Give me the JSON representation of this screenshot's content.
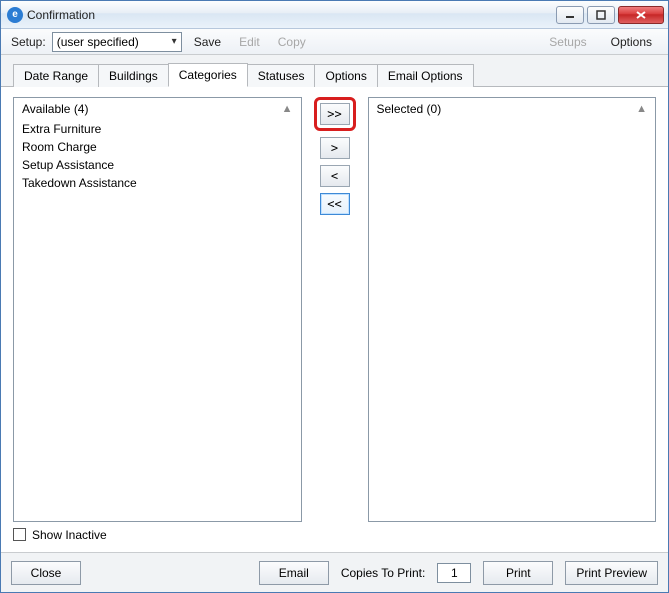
{
  "window": {
    "title": "Confirmation"
  },
  "toolbar": {
    "setup_label": "Setup:",
    "setup_value": "(user specified)",
    "save": "Save",
    "edit": "Edit",
    "copy": "Copy",
    "setups": "Setups",
    "options": "Options"
  },
  "tabs": {
    "date_range": "Date Range",
    "buildings": "Buildings",
    "categories": "Categories",
    "statuses": "Statuses",
    "options": "Options",
    "email_options": "Email Options"
  },
  "available": {
    "header": "Available (4)",
    "items": [
      "Extra Furniture",
      "Room Charge",
      "Setup Assistance",
      "Takedown Assistance"
    ]
  },
  "selected": {
    "header": "Selected (0)"
  },
  "move_buttons": {
    "all_right": ">>",
    "right": ">",
    "left": "<",
    "all_left": "<<"
  },
  "show_inactive_label": "Show Inactive",
  "footer": {
    "close": "Close",
    "email": "Email",
    "copies_label": "Copies To Print:",
    "copies_value": "1",
    "print": "Print",
    "print_preview": "Print Preview"
  }
}
